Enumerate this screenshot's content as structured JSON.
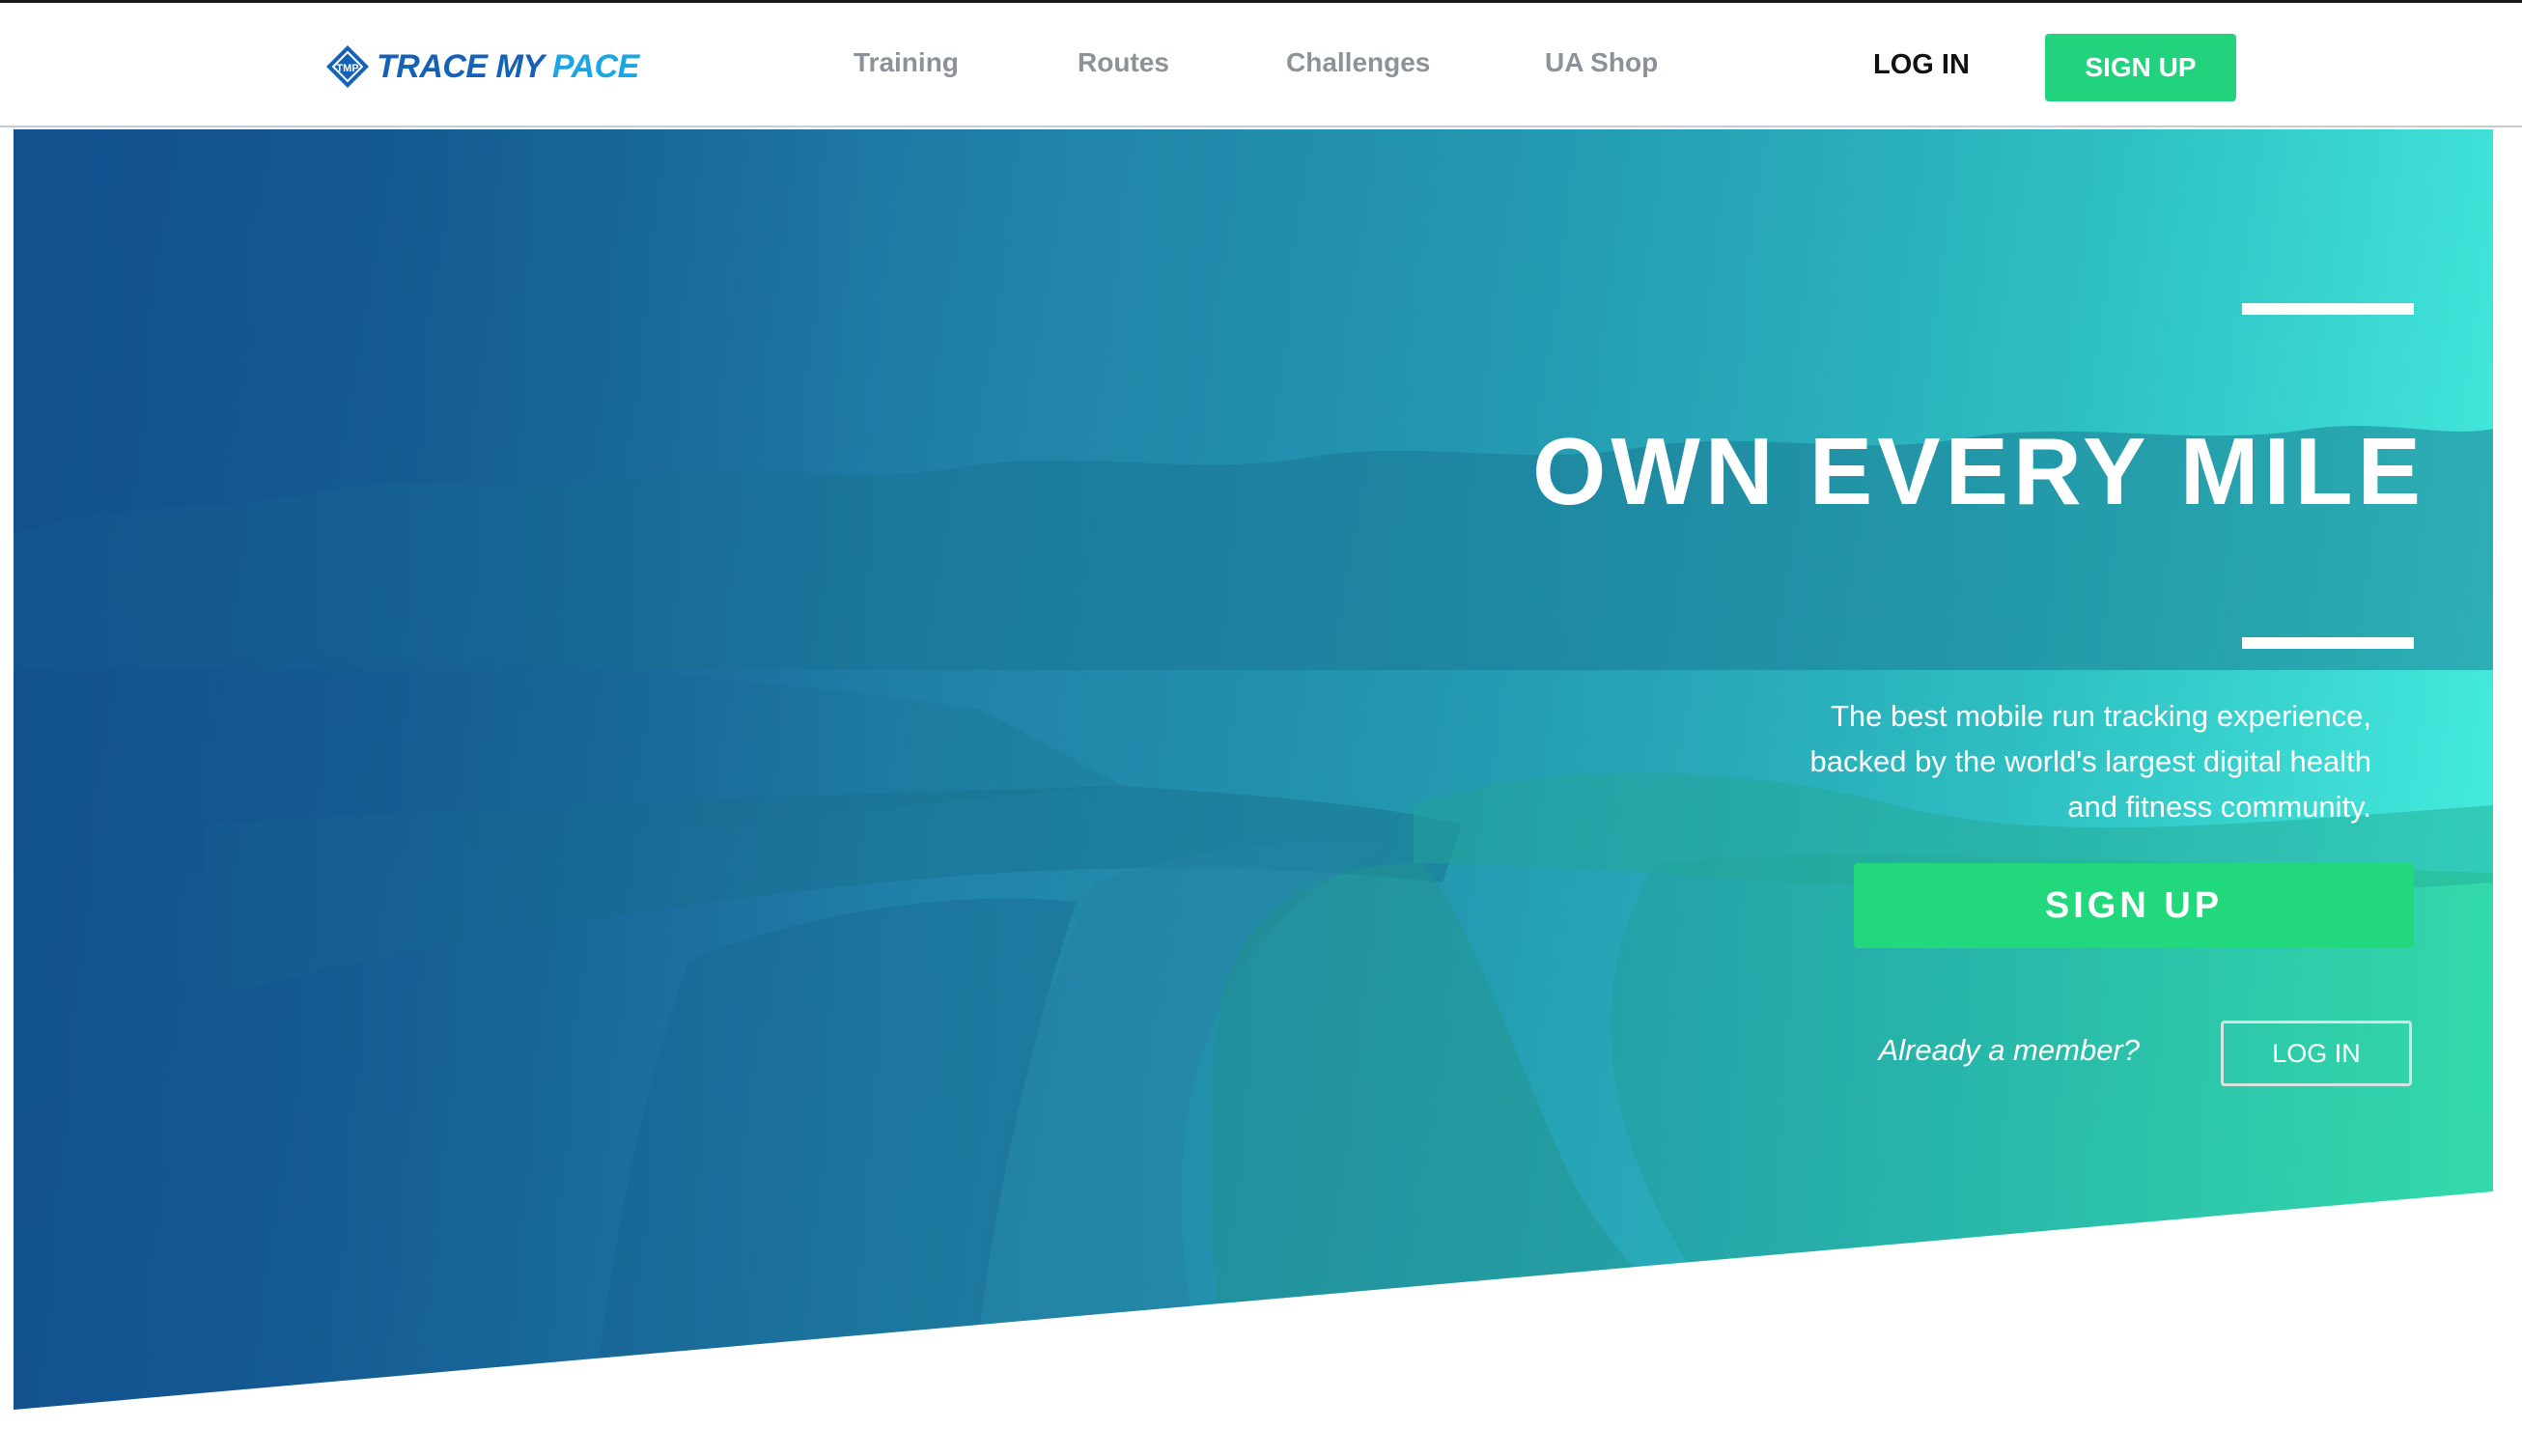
{
  "header": {
    "logo": {
      "word1": "TRACE MY",
      "word2": "PACE",
      "mark_text": "TMP"
    },
    "nav": [
      {
        "label": "Training"
      },
      {
        "label": "Routes"
      },
      {
        "label": "Challenges"
      },
      {
        "label": "UA Shop"
      }
    ],
    "login_label": "LOG IN",
    "signup_label": "SIGN UP"
  },
  "hero": {
    "headline": "OWN EVERY MILE",
    "tagline": "The best mobile run tracking experience, backed by the world's largest digital health and fitness community.",
    "signup_label": "SIGN UP",
    "member_prompt": "Already a member?",
    "login_label": "LOG IN"
  },
  "colors": {
    "brand_blue": "#1462b8",
    "brand_light_blue": "#1aa6e6",
    "cta_green": "#23d27d",
    "nav_gray": "#8d9298",
    "hero_gradient_start": "#13508e",
    "hero_gradient_end": "#48f2e2"
  }
}
